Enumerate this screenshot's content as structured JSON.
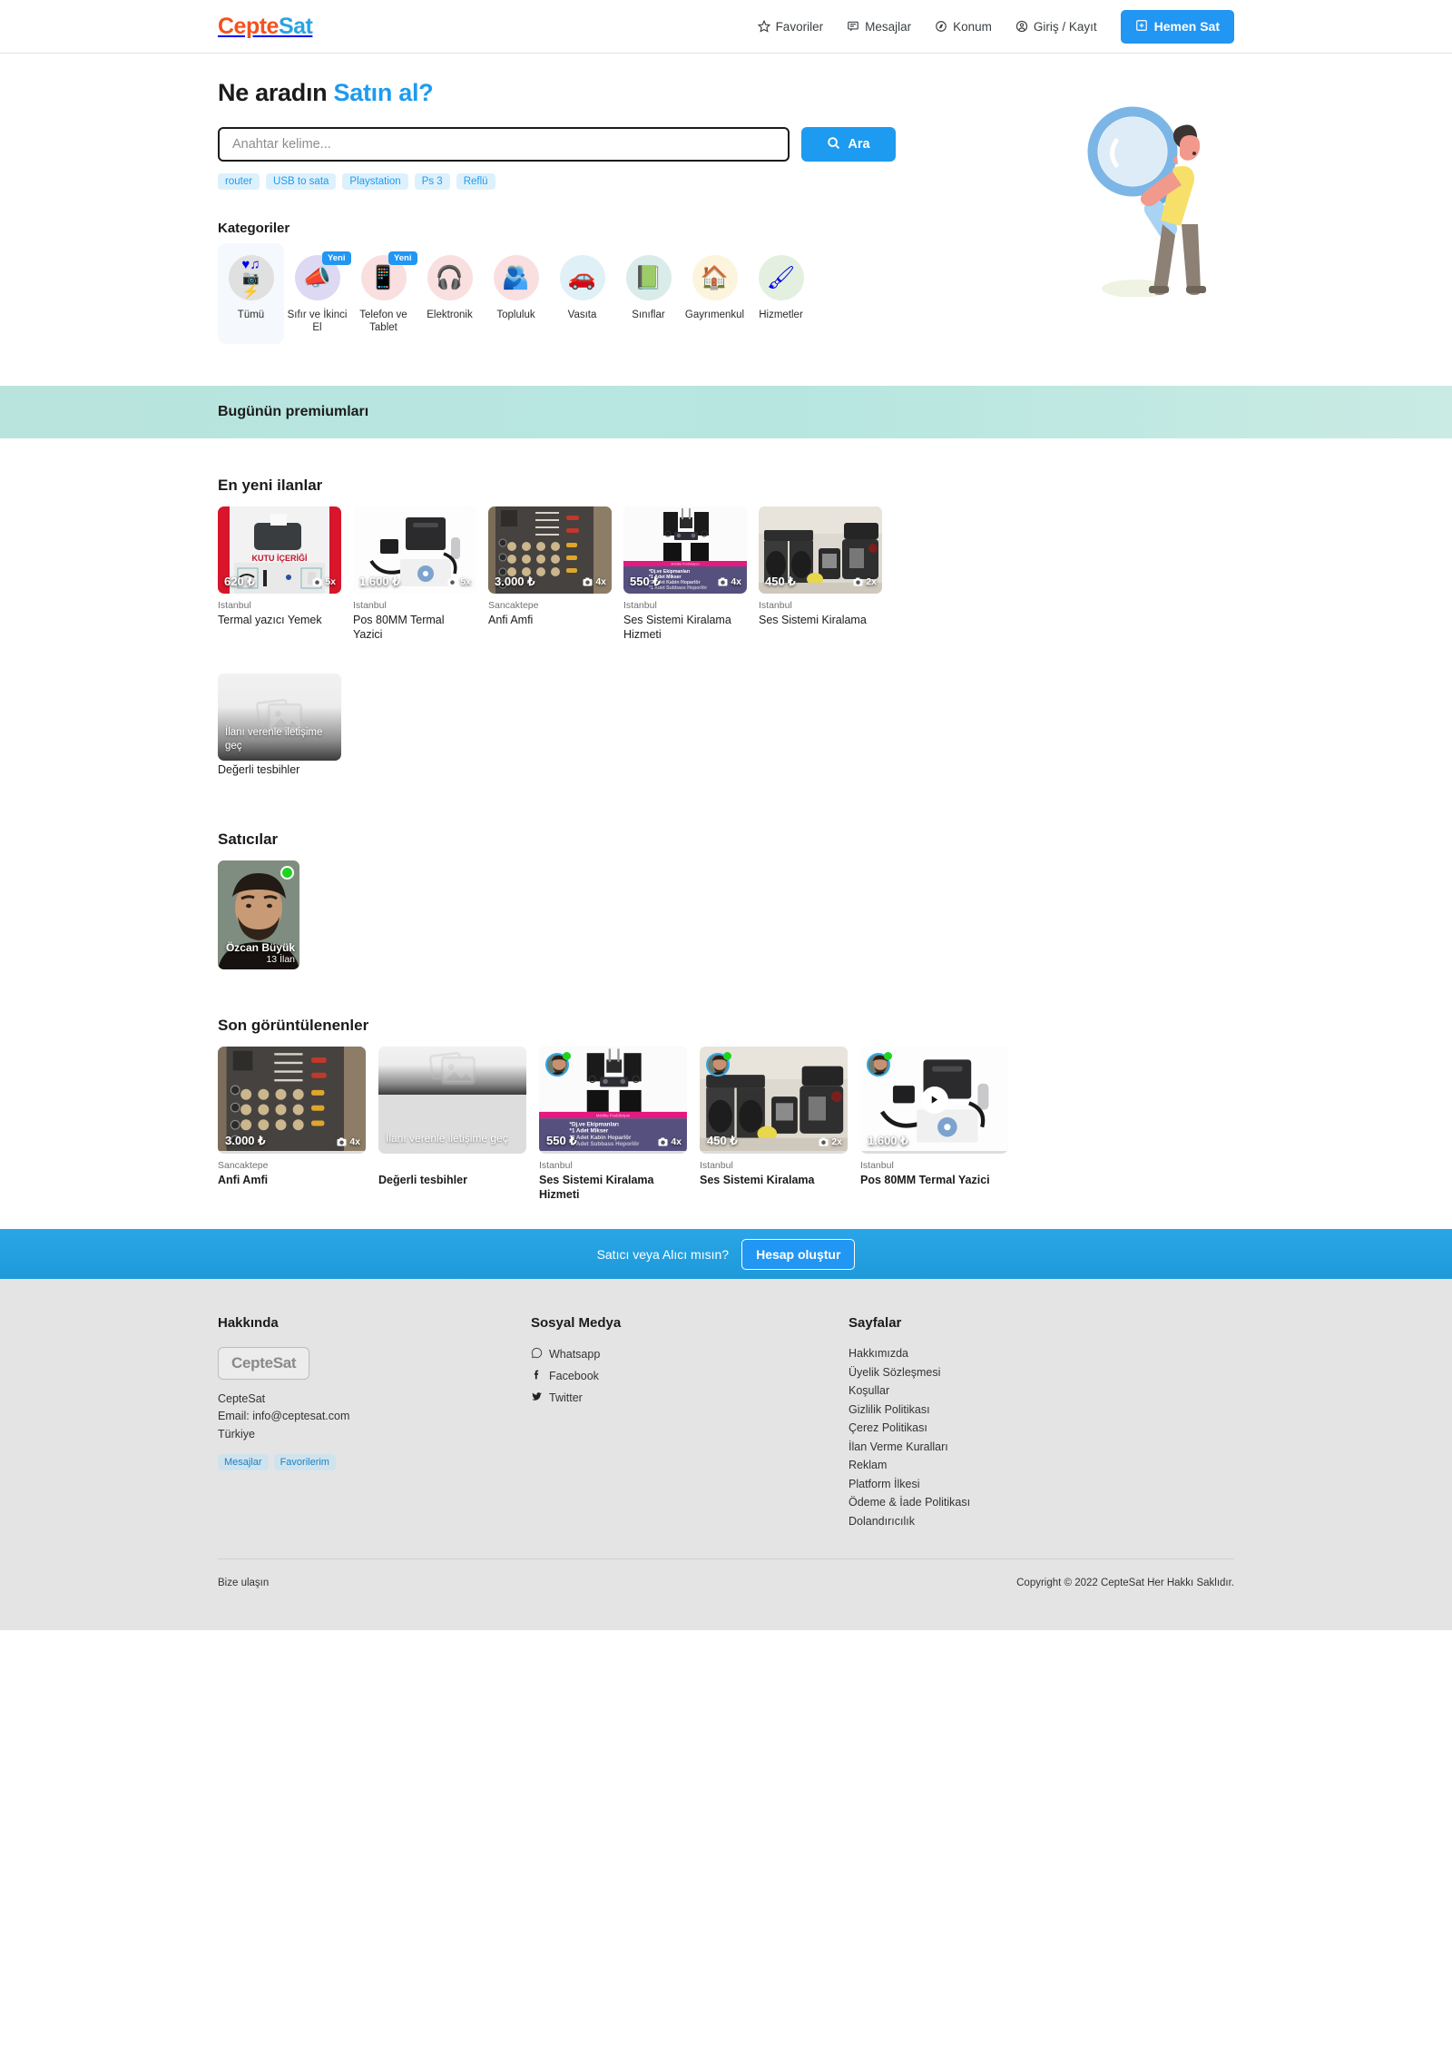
{
  "brand": {
    "name_part1": "Cepte",
    "name_part2": "Sat",
    "accent_orange": "#f4511e",
    "accent_blue": "#29a3e3"
  },
  "topnav": {
    "links": [
      {
        "label": "Favoriler",
        "icon": "star-icon"
      },
      {
        "label": "Mesajlar",
        "icon": "message-icon"
      },
      {
        "label": "Konum",
        "icon": "location-icon"
      },
      {
        "label": "Giriş / Kayıt",
        "icon": "user-icon"
      }
    ],
    "sell_button": "Hemen Sat"
  },
  "hero": {
    "title_plain": "Ne aradın ",
    "title_accent": "Satın al?",
    "search_placeholder": "Anahtar kelime...",
    "search_value": "",
    "search_button": "Ara",
    "tags": [
      "router",
      "USB to sata",
      "Playstation",
      "Ps 3",
      "Reflü"
    ],
    "illustration": "man-with-magnifier-illustration"
  },
  "categories": {
    "heading": "Kategoriler",
    "items": [
      {
        "label": "Tümü",
        "icon": "all-categories-icon",
        "bg": "#e0e0e0",
        "glyph": "♥♫📷⚡",
        "active": true,
        "badge": ""
      },
      {
        "label": "Sıfır ve İkinci El",
        "icon": "megaphone-icon",
        "bg": "#ddd9f3",
        "glyph": "📣",
        "active": false,
        "badge": "Yeni"
      },
      {
        "label": "Telefon ve Tablet",
        "icon": "phone-tablet-icon",
        "bg": "#fadfe0",
        "glyph": "📱",
        "active": false,
        "badge": "Yeni"
      },
      {
        "label": "Elektronik",
        "icon": "electronics-icon",
        "bg": "#fadfe0",
        "glyph": "🎧",
        "active": false,
        "badge": ""
      },
      {
        "label": "Topluluk",
        "icon": "community-icon",
        "bg": "#fadfe0",
        "glyph": "🫂",
        "active": false,
        "badge": ""
      },
      {
        "label": "Vasıta",
        "icon": "car-icon",
        "bg": "#dff0f7",
        "glyph": "🚗",
        "active": false,
        "badge": ""
      },
      {
        "label": "Sınıflar",
        "icon": "classes-icon",
        "bg": "#d9ecea",
        "glyph": "📗",
        "active": false,
        "badge": ""
      },
      {
        "label": "Gayrımenkul",
        "icon": "house-icon",
        "bg": "#fcf4dc",
        "glyph": "🏠",
        "active": false,
        "badge": ""
      },
      {
        "label": "Hizmetler",
        "icon": "paintroller-icon",
        "bg": "#e4f0df",
        "glyph": "🖌",
        "active": false,
        "badge": ""
      }
    ]
  },
  "premium_band": {
    "title": "Bugünün premiumları"
  },
  "newest": {
    "title": "En yeni ilanlar",
    "items": [
      {
        "price": "620 ₺",
        "photos": "5x",
        "location": "Istanbul",
        "name": "Termal yazıcı Yemek",
        "image": "thermal-printer-red-banner",
        "placeholder": false,
        "overlay": ""
      },
      {
        "price": "1.600 ₺",
        "photos": "5x",
        "location": "Istanbul",
        "name": "Pos 80MM Termal Yazici",
        "image": "pos-printer-white",
        "placeholder": false,
        "overlay": ""
      },
      {
        "price": "3.000 ₺",
        "photos": "4x",
        "location": "Sancaktepe",
        "name": "Anfi Amfi",
        "image": "audio-mixer",
        "placeholder": false,
        "overlay": ""
      },
      {
        "price": "550 ₺",
        "photos": "4x",
        "location": "Istanbul",
        "name": "Ses Sistemi Kiralama Hizmeti",
        "image": "dj-sound-system-poster",
        "placeholder": false,
        "overlay": ""
      },
      {
        "price": "450 ₺",
        "photos": "2x",
        "location": "Istanbul",
        "name": "Ses Sistemi Kiralama",
        "image": "speakers-stack",
        "placeholder": false,
        "overlay": ""
      },
      {
        "price": "",
        "photos": "",
        "location": "",
        "name": "Değerli tesbihler",
        "image": "no-image-placeholder",
        "placeholder": true,
        "overlay": "İlanı verenle iletişime geç"
      }
    ]
  },
  "sellers": {
    "title": "Satıcılar",
    "items": [
      {
        "name": "Özcan Büyük",
        "count": "13 İlan",
        "online": true,
        "avatar": "seller-photo"
      }
    ]
  },
  "recent": {
    "title": "Son görüntülenenler",
    "items": [
      {
        "price": "3.000 ₺",
        "photos": "4x",
        "location": "Sancaktepe",
        "name": "Anfi Amfi",
        "image": "audio-mixer",
        "placeholder": false,
        "overlay": "",
        "avatar": false,
        "play": false
      },
      {
        "price": "",
        "photos": "",
        "location": "",
        "name": "Değerli tesbihler",
        "image": "no-image-placeholder",
        "placeholder": true,
        "overlay": "İlanı verenle iletişime geç",
        "avatar": false,
        "play": false
      },
      {
        "price": "550 ₺",
        "photos": "4x",
        "location": "Istanbul",
        "name": "Ses Sistemi Kiralama Hizmeti",
        "image": "dj-sound-system-poster",
        "placeholder": false,
        "overlay": "",
        "avatar": true,
        "play": false
      },
      {
        "price": "450 ₺",
        "photos": "2x",
        "location": "Istanbul",
        "name": "Ses Sistemi Kiralama",
        "image": "speakers-stack",
        "placeholder": false,
        "overlay": "",
        "avatar": true,
        "play": false
      },
      {
        "price": "1.600 ₺",
        "photos": "",
        "location": "Istanbul",
        "name": "Pos 80MM Termal Yazici",
        "image": "pos-printer-white",
        "placeholder": false,
        "overlay": "",
        "avatar": true,
        "play": true
      }
    ]
  },
  "cta": {
    "text": "Satıcı veya Alıcı mısın?",
    "button": "Hesap oluştur"
  },
  "footer": {
    "about": {
      "heading": "Hakkında",
      "logo_text": "CepteSat",
      "line1": "CepteSat",
      "line2": "Email: info@ceptesat.com",
      "line3": "Türkiye",
      "chips": [
        "Mesajlar",
        "Favorilerim"
      ]
    },
    "social": {
      "heading": "Sosyal Medya",
      "items": [
        {
          "label": "Whatsapp",
          "icon": "whatsapp-icon"
        },
        {
          "label": "Facebook",
          "icon": "facebook-icon"
        },
        {
          "label": "Twitter",
          "icon": "twitter-icon"
        }
      ]
    },
    "pages": {
      "heading": "Sayfalar",
      "items": [
        "Hakkımızda",
        "Üyelik Sözleşmesi",
        "Koşullar",
        "Gizlilik Politikası",
        "Çerez Politikası",
        "İlan Verme Kuralları",
        "Reklam",
        "Platform İlkesi",
        "Ödeme & İade Politikası",
        "Dolandırıcılık"
      ]
    },
    "bottom": {
      "contact": "Bize ulaşın",
      "copyright": "Copyright © 2022 CepteSat Her Hakkı Saklıdır."
    }
  }
}
